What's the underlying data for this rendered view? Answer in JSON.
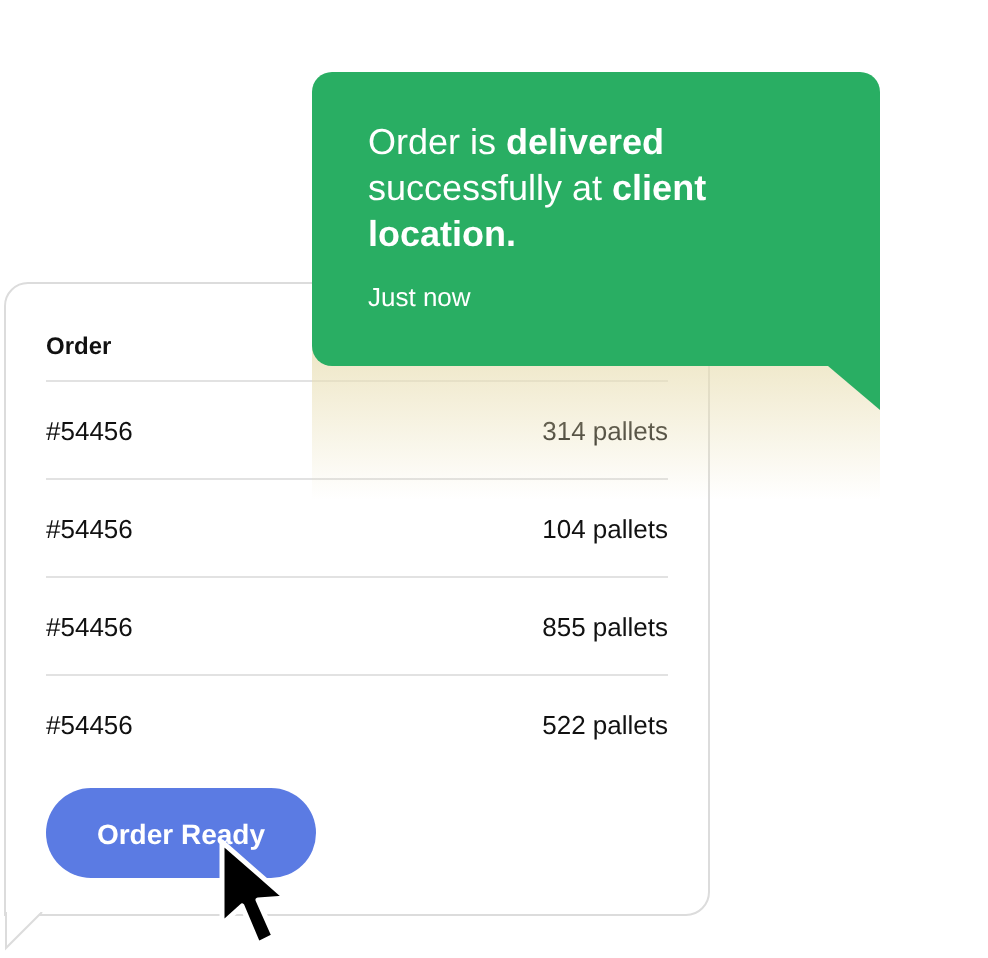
{
  "table": {
    "columns": [
      "Order"
    ],
    "rows": [
      {
        "order": "#54456",
        "column_2": "314 pallets"
      },
      {
        "order": "#54456",
        "column_2": "104 pallets"
      },
      {
        "order": "#54456",
        "column_2": "855 pallets"
      },
      {
        "order": "#54456",
        "column_2": "522 pallets"
      }
    ]
  },
  "button": {
    "label": "Order Ready"
  },
  "notification": {
    "message": "Order is **delivered** successfully at **client location.**",
    "time": "Just now"
  }
}
